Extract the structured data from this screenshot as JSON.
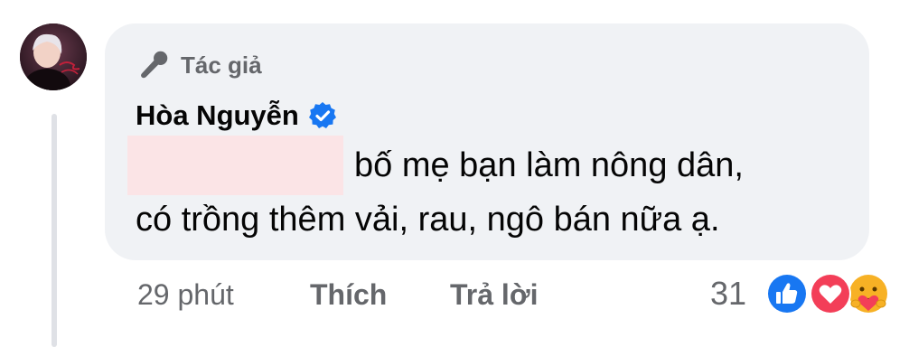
{
  "comment": {
    "author_badge": "Tác giả",
    "author_name": "Hòa Nguyễn",
    "text_line1": "bố mẹ bạn làm nông dân,",
    "text_line2": "có trồng thêm vải, rau, ngô bán nữa ạ."
  },
  "meta": {
    "time": "29 phút",
    "like_label": "Thích",
    "reply_label": "Trả lời"
  },
  "reactions": {
    "count": "31",
    "icons": [
      "like-icon",
      "love-icon",
      "care-icon"
    ],
    "colors": {
      "like": "#1877f2",
      "love": "#f33e58",
      "care": "#f7b125"
    }
  },
  "colors": {
    "bubble": "#f0f2f5",
    "secondary_text": "#65676b",
    "primary_text": "#050505",
    "verified": "#1877f2"
  }
}
